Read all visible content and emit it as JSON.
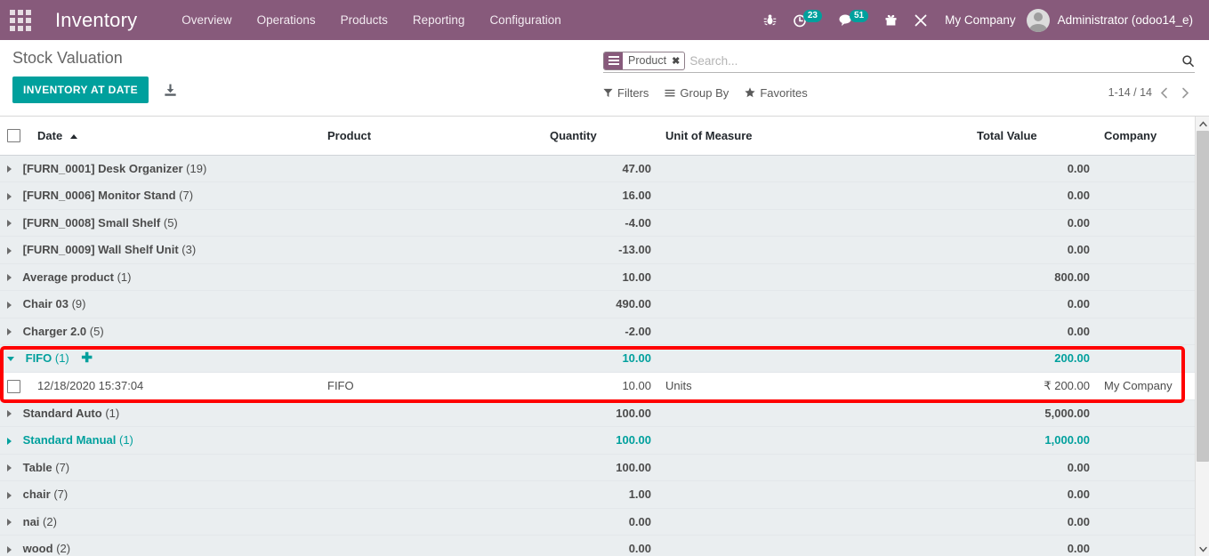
{
  "navbar": {
    "apps_icon": "apps-grid-icon",
    "brand": "Inventory",
    "menu": [
      {
        "label": "Overview"
      },
      {
        "label": "Operations"
      },
      {
        "label": "Products"
      },
      {
        "label": "Reporting"
      },
      {
        "label": "Configuration"
      }
    ],
    "icons": [
      {
        "name": "bug-icon",
        "badge": null
      },
      {
        "name": "activity-clock-icon",
        "badge": "23"
      },
      {
        "name": "messages-icon",
        "badge": "51"
      },
      {
        "name": "gift-icon",
        "badge": null
      },
      {
        "name": "tools-icon",
        "badge": null
      }
    ],
    "company": "My Company",
    "user": "Administrator (odoo14_e)"
  },
  "control_panel": {
    "title": "Stock Valuation",
    "primary_button": "INVENTORY AT DATE",
    "download_icon": "download-icon",
    "search": {
      "facet_icon": "group-by-icon",
      "facet_label": "Product",
      "facet_close": "✖",
      "placeholder": "Search...",
      "value": "",
      "magnifier_icon": "search-icon"
    },
    "filters": [
      {
        "label": "Filters",
        "icon": "filter-icon"
      },
      {
        "label": "Group By",
        "icon": "list-icon"
      },
      {
        "label": "Favorites",
        "icon": "star-icon"
      }
    ],
    "pager": {
      "range": "1-14 / 14",
      "prev_icon": "chevron-left-icon",
      "next_icon": "chevron-right-icon"
    }
  },
  "table": {
    "columns": [
      {
        "key": "date",
        "label": "Date",
        "sorted": "asc"
      },
      {
        "key": "product",
        "label": "Product"
      },
      {
        "key": "quantity",
        "label": "Quantity"
      },
      {
        "key": "uom",
        "label": "Unit of Measure"
      },
      {
        "key": "total_value",
        "label": "Total Value"
      },
      {
        "key": "company",
        "label": "Company"
      }
    ],
    "rows": [
      {
        "type": "group",
        "label": "[FURN_0001] Desk Organizer",
        "count": "(19)",
        "quantity": "47.00",
        "total_value": "0.00",
        "state": "collapsed",
        "highlight": false
      },
      {
        "type": "group",
        "label": "[FURN_0006] Monitor Stand",
        "count": "(7)",
        "quantity": "16.00",
        "total_value": "0.00",
        "state": "collapsed",
        "highlight": false
      },
      {
        "type": "group",
        "label": "[FURN_0008] Small Shelf",
        "count": "(5)",
        "quantity": "-4.00",
        "total_value": "0.00",
        "state": "collapsed",
        "highlight": false
      },
      {
        "type": "group",
        "label": "[FURN_0009] Wall Shelf Unit",
        "count": "(3)",
        "quantity": "-13.00",
        "total_value": "0.00",
        "state": "collapsed",
        "highlight": false
      },
      {
        "type": "group",
        "label": "Average product",
        "count": "(1)",
        "quantity": "10.00",
        "total_value": "800.00",
        "state": "collapsed",
        "highlight": false
      },
      {
        "type": "group",
        "label": "Chair 03",
        "count": "(9)",
        "quantity": "490.00",
        "total_value": "0.00",
        "state": "collapsed",
        "highlight": false
      },
      {
        "type": "group",
        "label": "Charger 2.0",
        "count": "(5)",
        "quantity": "-2.00",
        "total_value": "0.00",
        "state": "collapsed",
        "highlight": false
      },
      {
        "type": "group",
        "label": "FIFO",
        "count": "(1)",
        "quantity": "10.00",
        "total_value": "200.00",
        "state": "expanded",
        "highlight": true,
        "add_icon": "✚"
      },
      {
        "type": "record",
        "date": "12/18/2020 15:37:04",
        "product": "FIFO",
        "quantity": "10.00",
        "uom": "Units",
        "total_value": "₹ 200.00",
        "company": "My Company",
        "highlight": true
      },
      {
        "type": "group",
        "label": "Standard Auto",
        "count": "(1)",
        "quantity": "100.00",
        "total_value": "5,000.00",
        "state": "collapsed",
        "highlight": false
      },
      {
        "type": "group",
        "label": "Standard Manual",
        "count": "(1)",
        "quantity": "100.00",
        "total_value": "1,000.00",
        "state": "collapsed",
        "highlight": true
      },
      {
        "type": "group",
        "label": "Table",
        "count": "(7)",
        "quantity": "100.00",
        "total_value": "0.00",
        "state": "collapsed",
        "highlight": false
      },
      {
        "type": "group",
        "label": "chair",
        "count": "(7)",
        "quantity": "1.00",
        "total_value": "0.00",
        "state": "collapsed",
        "highlight": false
      },
      {
        "type": "group",
        "label": "nai",
        "count": "(2)",
        "quantity": "0.00",
        "total_value": "0.00",
        "state": "collapsed",
        "highlight": false
      },
      {
        "type": "group",
        "label": "wood",
        "count": "(2)",
        "quantity": "0.00",
        "total_value": "0.00",
        "state": "collapsed",
        "highlight": false
      }
    ]
  },
  "annotation": {
    "name": "red-highlight-rectangle",
    "color": "#ff0000"
  },
  "colors": {
    "brand_purple": "#875A7B",
    "accent_teal": "#00A09D",
    "group_row_bg": "#EAEEF0",
    "highlight_red": "#ff0000"
  }
}
